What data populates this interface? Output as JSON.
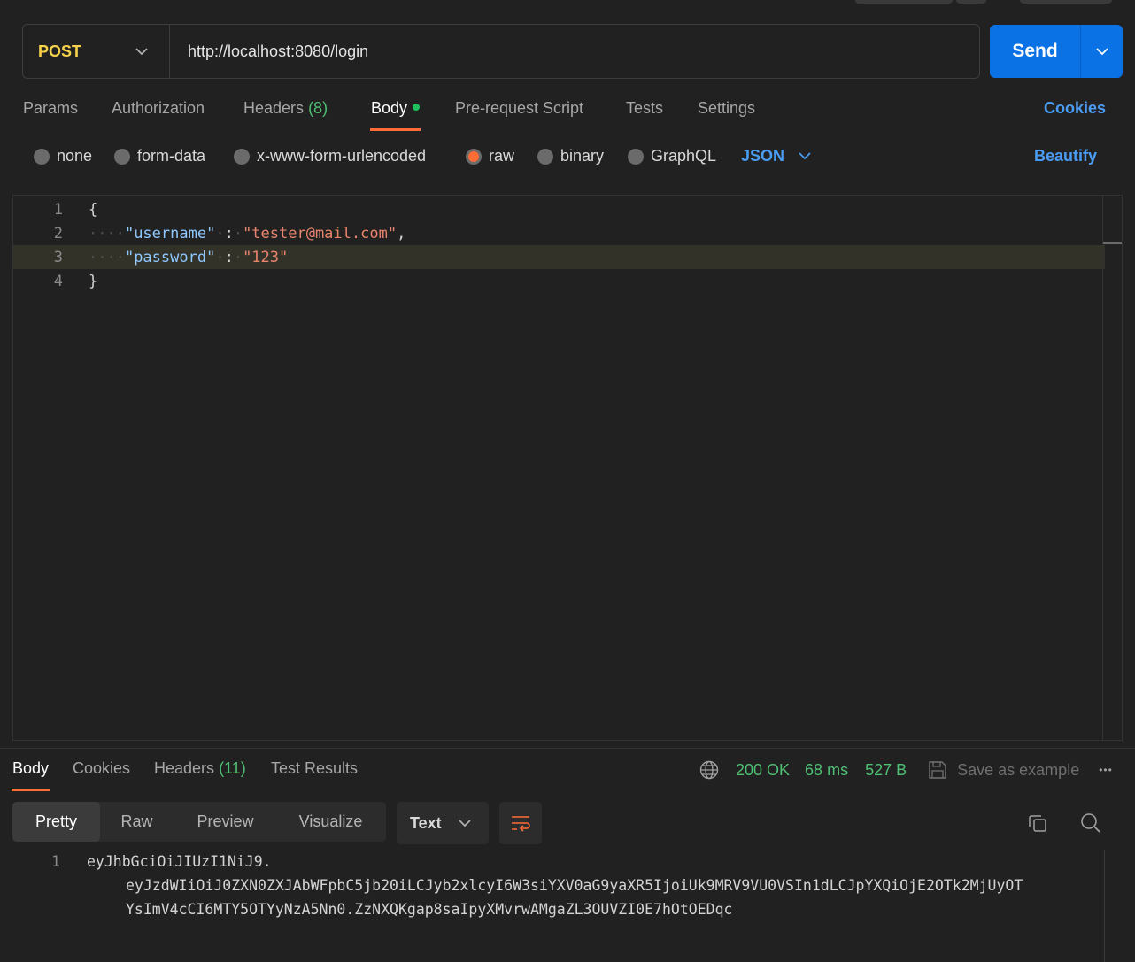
{
  "request": {
    "method": "POST",
    "url": "http://localhost:8080/login",
    "send_label": "Send"
  },
  "request_tabs": [
    {
      "label": "Params"
    },
    {
      "label": "Authorization"
    },
    {
      "label": "Headers",
      "count": "(8)"
    },
    {
      "label": "Body",
      "active": true
    },
    {
      "label": "Pre-request Script"
    },
    {
      "label": "Tests"
    },
    {
      "label": "Settings"
    }
  ],
  "cookies_link": "Cookies",
  "body_types": [
    {
      "label": "none",
      "selected": false
    },
    {
      "label": "form-data",
      "selected": false
    },
    {
      "label": "x-www-form-urlencoded",
      "selected": false
    },
    {
      "label": "raw",
      "selected": true
    },
    {
      "label": "binary",
      "selected": false
    },
    {
      "label": "GraphQL",
      "selected": false
    }
  ],
  "raw_format": "JSON",
  "beautify_label": "Beautify",
  "editor": {
    "line_numbers": [
      "1",
      "2",
      "3",
      "4"
    ],
    "open_brace": "{",
    "close_brace": "}",
    "username_key": "\"username\"",
    "username_value": "\"tester@mail.com\"",
    "password_key": "\"password\"",
    "password_value": "\"123\"",
    "colon": ":",
    "comma": ","
  },
  "response_tabs": [
    {
      "label": "Body",
      "active": true
    },
    {
      "label": "Cookies"
    },
    {
      "label": "Headers",
      "count": "(11)"
    },
    {
      "label": "Test Results"
    }
  ],
  "response_meta": {
    "status": "200 OK",
    "time": "68 ms",
    "size": "527 B",
    "save_example": "Save as example",
    "more": "•••"
  },
  "view_modes": [
    "Pretty",
    "Raw",
    "Preview",
    "Visualize"
  ],
  "response_format": "Text",
  "response_body": {
    "line_number": "1",
    "lines": [
      "eyJhbGciOiJIUzI1NiJ9.",
      "eyJzdWIiOiJ0ZXN0ZXJAbWFpbC5jb20iLCJyb2xlcyI6W3siYXV0aG9yaXR5IjoiUk9MRV9VU0VSIn1dLCJpYXQiOjE2OTk2MjUyOT",
      "YsImV4cCI6MTY5OTYyNzA5Nn0.ZzNXQKgap8saIpyXMvrwAMgaZL3OUVZI0E7hOtOEDqc"
    ]
  },
  "colors": {
    "accent": "#ff6c37",
    "send": "#0b72e5",
    "method": "#f5d14c",
    "success": "#4fbf73",
    "link": "#4a9cf2"
  }
}
